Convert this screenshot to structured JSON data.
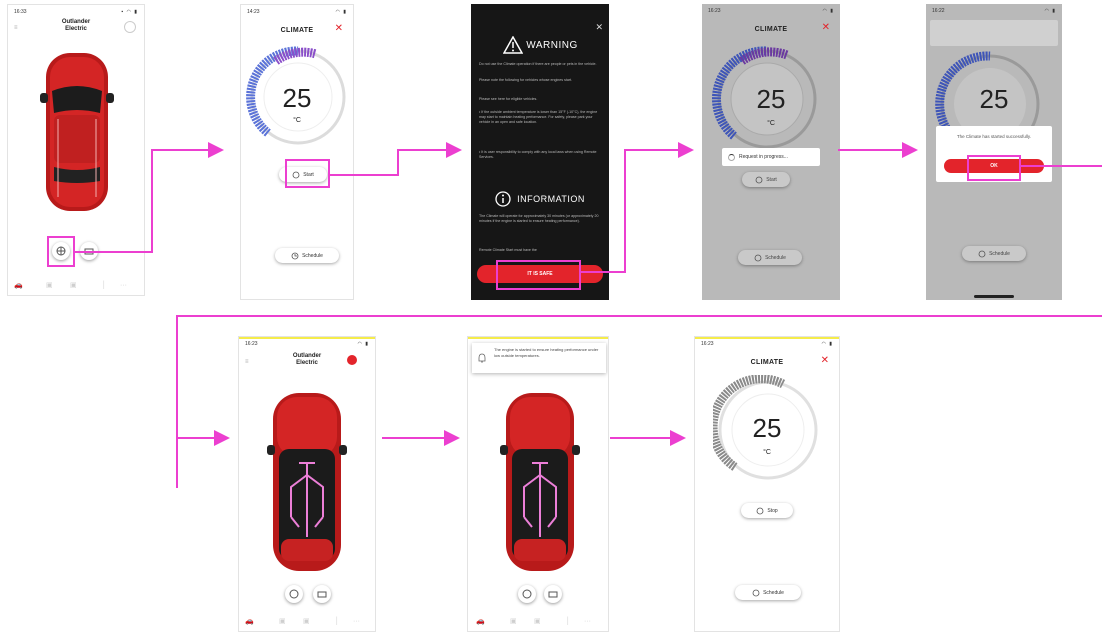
{
  "status_times": [
    "16:33",
    "14:23",
    "16:23",
    "16:22",
    "16:23",
    "16:23",
    "16:23"
  ],
  "vehicle": {
    "name": "Outlander\nElectric"
  },
  "climate": {
    "title": "CLIMATE",
    "temperature": "25",
    "unit": "°C",
    "start_label": "Start",
    "stop_label": "Stop",
    "schedule_label": "Schedule"
  },
  "warning": {
    "title": "WARNING",
    "p1": "Do not use the Climate operation if there are people or pets in the vehicle.",
    "p2": "Please note the following for vehicles whose engines start.",
    "p3": "Please see here for eligible vehicles.",
    "p4": "• If the outside ambient temperature is lower than 15°F (-10°C), the engine may start to maintain heating performance. For safety, please park your vehicle in an open and safe location.",
    "p5": "• It is user responsibility to comply with any local laws when using Remote Services.",
    "info_title": "INFORMATION",
    "p6": "The Climate will operate for approximately 30 minutes (or approximately 20 minutes if the engine is started to ensure heating performance).",
    "p7": "Remote Climate Start must have the",
    "safe_button": "IT IS SAFE"
  },
  "progress": {
    "text": "Request in progress..."
  },
  "started": {
    "text": "The Climate has started successfully.",
    "ok": "OK"
  },
  "notification": {
    "text": "The engine is started to ensure heating performance under low outside temperatures."
  },
  "colors": {
    "accent": "#e3242b",
    "flow": "#ec3fd0",
    "dial_active": "#5b73d8",
    "dial_warm": "#8a4fc9"
  }
}
